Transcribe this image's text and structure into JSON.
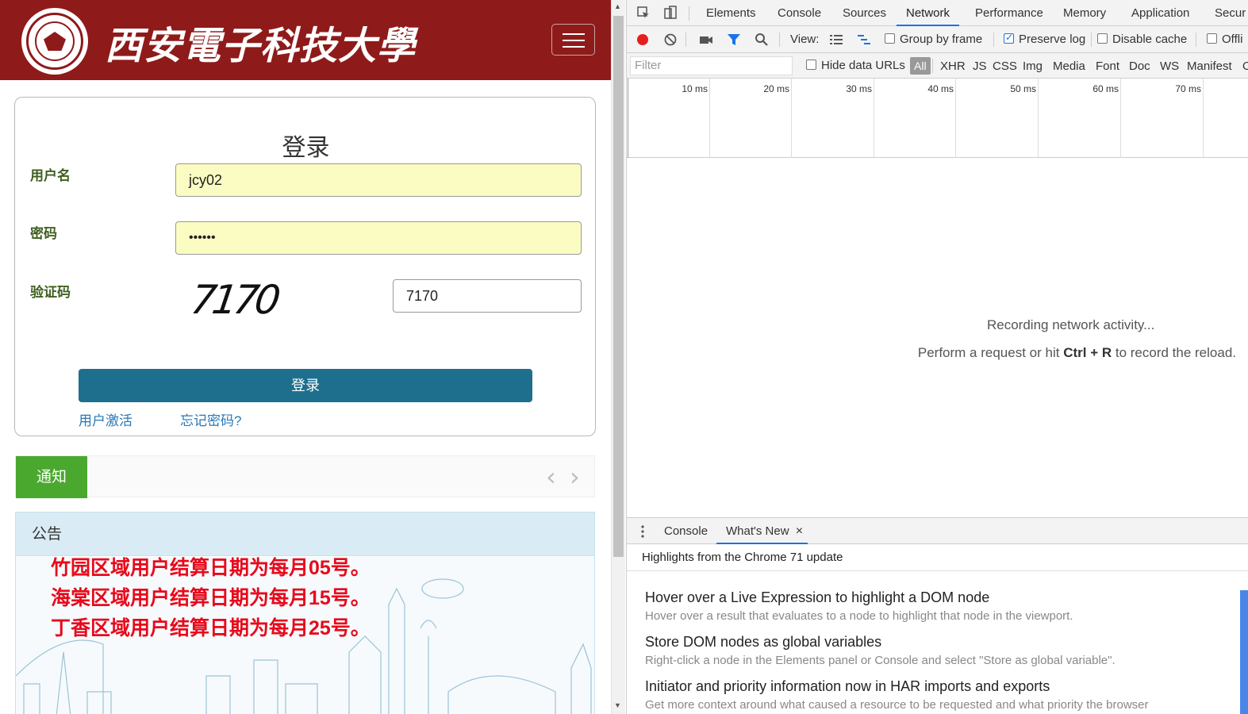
{
  "page": {
    "university_name": "西安電子科技大學",
    "seal_text": "XIDIAN UNIVERSITY",
    "login": {
      "title": "登录",
      "username_label": "用户名",
      "username_value": "jcy02",
      "password_label": "密码",
      "password_value": "••••••",
      "captcha_label": "验证码",
      "captcha_image_text": "7170",
      "captcha_value": "7170",
      "submit_label": "登录",
      "activate_link": "用户激活",
      "forgot_link": "忘记密码?"
    },
    "notice": {
      "tag": "通知",
      "prev_icon": "‹",
      "next_icon": "›"
    },
    "announcement": {
      "heading": "公告",
      "lines": [
        "竹园区域用户结算日期为每月05号。",
        "海棠区域用户结算日期为每月15号。",
        "丁香区域用户结算日期为每月25号。"
      ]
    }
  },
  "devtools": {
    "tabs": [
      "Elements",
      "Console",
      "Sources",
      "Network",
      "Performance",
      "Memory",
      "Application",
      "Secur"
    ],
    "active_tab": "Network",
    "toolbar": {
      "view_label": "View:",
      "group_by_frame": "Group by frame",
      "preserve_log": "Preserve log",
      "disable_cache": "Disable cache",
      "offline": "Offli"
    },
    "filter": {
      "placeholder": "Filter",
      "hide_data_urls": "Hide data URLs",
      "types": [
        "All",
        "XHR",
        "JS",
        "CSS",
        "Img",
        "Media",
        "Font",
        "Doc",
        "WS",
        "Manifest",
        "O"
      ]
    },
    "timeline_labels": [
      "10 ms",
      "20 ms",
      "30 ms",
      "40 ms",
      "50 ms",
      "60 ms",
      "70 ms"
    ],
    "recording": {
      "line1": "Recording network activity...",
      "line2_prefix": "Perform a request or hit ",
      "line2_key": "Ctrl + R",
      "line2_suffix": " to record the reload."
    },
    "drawer": {
      "tabs": [
        "Console",
        "What's New"
      ],
      "close_icon": "×",
      "heading": "Highlights from the Chrome 71 update",
      "items": [
        {
          "title": "Hover over a Live Expression to highlight a DOM node",
          "desc": "Hover over a result that evaluates to a node to highlight that node in the viewport."
        },
        {
          "title": "Store DOM nodes as global variables",
          "desc": "Right-click a node in the Elements panel or Console and select \"Store as global variable\"."
        },
        {
          "title": "Initiator and priority information now in HAR imports and exports",
          "desc": "Get more context around what caused a resource to be requested and what priority the browser"
        }
      ]
    }
  },
  "colors": {
    "header_red": "#8f1a1a",
    "login_button": "#1e6f8e",
    "notice_green": "#4aa82e",
    "announce_red": "#e8091b",
    "devtools_accent": "#1a73e8"
  }
}
